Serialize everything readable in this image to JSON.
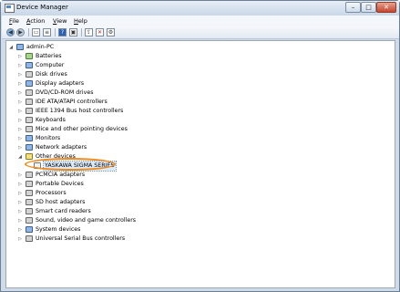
{
  "window": {
    "title": "Device Manager"
  },
  "menu": [
    {
      "label": "File",
      "ul": "F",
      "rest": "ile"
    },
    {
      "label": "Action",
      "ul": "A",
      "rest": "ction"
    },
    {
      "label": "View",
      "ul": "V",
      "rest": "iew"
    },
    {
      "label": "Help",
      "ul": "H",
      "rest": "elp"
    }
  ],
  "toolbar": [
    "back-icon",
    "forward-icon",
    "show-hide-tree-icon",
    "properties-icon",
    "help-icon",
    "scan-hardware-icon",
    "update-driver-icon",
    "uninstall-icon",
    "disable-icon"
  ],
  "tree": {
    "root": "admin-PC",
    "items": [
      "Batteries",
      "Computer",
      "Disk drives",
      "Display adapters",
      "DVD/CD-ROM drives",
      "IDE ATA/ATAPI controllers",
      "IEEE 1394 Bus host controllers",
      "Keyboards",
      "Mice and other pointing devices",
      "Monitors",
      "Network adapters",
      "Other devices",
      "YASKAWA SIGMA SERIES",
      "PCMCIA adapters",
      "Portable Devices",
      "Processors",
      "SD host adapters",
      "Smart card readers",
      "Sound, video and game controllers",
      "System devices",
      "Universal Serial Bus controllers"
    ]
  }
}
